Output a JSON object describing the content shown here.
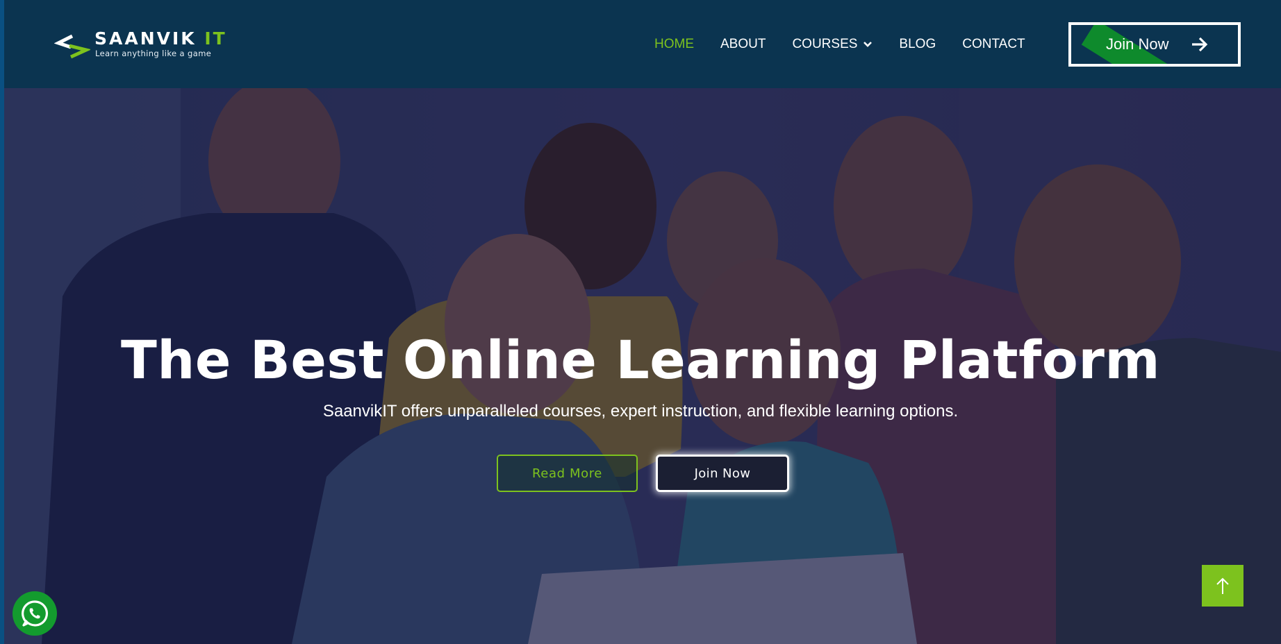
{
  "brand": {
    "name_part1": "SAANVIK ",
    "name_part2": "IT",
    "tagline": "Learn anything like a game",
    "logo_icon": "chevron-logo-icon"
  },
  "nav": {
    "items": [
      {
        "label": "HOME",
        "active": true
      },
      {
        "label": "ABOUT",
        "active": false
      },
      {
        "label": "COURSES",
        "active": false,
        "has_dropdown": true
      },
      {
        "label": "BLOG",
        "active": false
      },
      {
        "label": "CONTACT",
        "active": false
      }
    ]
  },
  "header_cta": {
    "label": "Join Now",
    "icon": "arrow-right-icon"
  },
  "hero": {
    "title": "The Best Online Learning Platform",
    "subtitle": "SaanvikIT offers unparalleled courses, expert instruction, and flexible learning options.",
    "primary_button": "Read More",
    "secondary_button": "Join Now",
    "background": "group-of-students-looking-at-laptop-photo"
  },
  "floating": {
    "scroll_top_icon": "arrow-up-icon",
    "whatsapp_icon": "whatsapp-icon"
  },
  "colors": {
    "accent": "#7dc21e",
    "header_bg": "#0b3450",
    "stripe_green": "#0e8a2c",
    "whatsapp_green": "#139b2e"
  }
}
